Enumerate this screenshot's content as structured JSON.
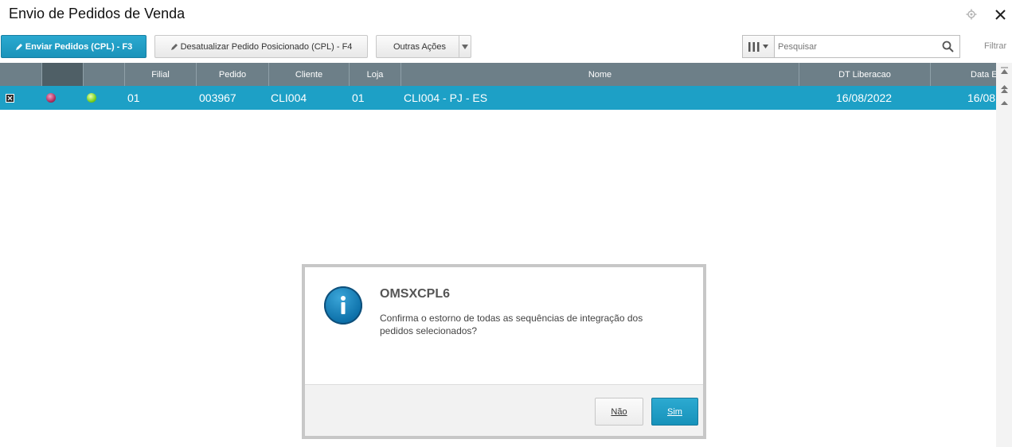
{
  "window": {
    "title": "Envio de Pedidos de Venda",
    "settings_icon": "gear-icon",
    "close_icon": "close-icon"
  },
  "toolbar": {
    "send_label": "Enviar Pedidos (CPL) - F3",
    "unsend_label": "Desatualizar Pedido Posicionado (CPL) - F4",
    "other_label": "Outras Ações",
    "search_placeholder": "Pesquisar",
    "filter_label": "Filtrar"
  },
  "grid": {
    "columns": [
      "",
      "",
      "",
      "Filial",
      "Pedido",
      "Cliente",
      "Loja",
      "Nome",
      "DT Liberacao",
      "Data E"
    ],
    "rows": [
      {
        "selected": true,
        "status_legend_1": "red",
        "status_legend_2": "green",
        "filial": "01",
        "pedido": "003967",
        "cliente": "CLI004",
        "loja": "01",
        "nome": "CLI004 - PJ - ES",
        "dt_liberacao": "16/08/2022",
        "data_e": "16/08"
      }
    ]
  },
  "dialog": {
    "title": "OMSXCPL6",
    "message": "Confirma o estorno de todas as sequências de integração dos pedidos selecionados?",
    "icon": "info-icon",
    "no_label": "Não",
    "yes_label": "Sim"
  },
  "colors": {
    "accent": "#1da0c6",
    "header": "#6d7f88"
  }
}
